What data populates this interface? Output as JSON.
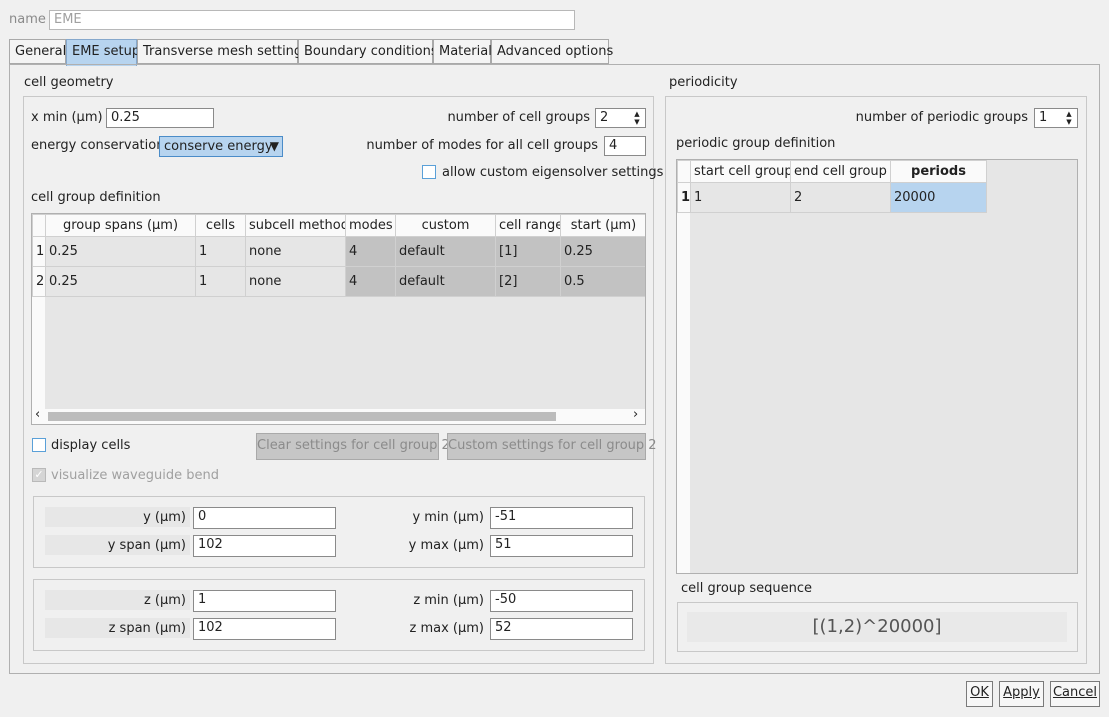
{
  "name_row": {
    "label": "name",
    "value": "EME"
  },
  "tabs": [
    {
      "label": "General"
    },
    {
      "label": "EME setup"
    },
    {
      "label": "Transverse mesh settings"
    },
    {
      "label": "Boundary conditions"
    },
    {
      "label": "Material"
    },
    {
      "label": "Advanced options"
    }
  ],
  "cell_geometry": {
    "title": "cell geometry",
    "xmin_label": "x min (μm)",
    "xmin_value": "0.25",
    "num_groups_label": "number of cell groups",
    "num_groups_value": "2",
    "energy_label": "energy conservation",
    "energy_value": "conserve energy",
    "num_modes_label": "number of modes for all cell groups",
    "num_modes_value": "4",
    "allow_custom_label": "allow custom eigensolver settings",
    "group_def_title": "cell group definition",
    "table": {
      "headers": [
        "group spans (μm)",
        "cells",
        "subcell method",
        "modes",
        "custom",
        "cell range",
        "start (μm)"
      ],
      "rows": [
        {
          "num": "1",
          "cells": [
            "0.25",
            "1",
            "none",
            "4",
            "default",
            "[1]",
            "0.25"
          ]
        },
        {
          "num": "2",
          "cells": [
            "0.25",
            "1",
            "none",
            "4",
            "default",
            "[2]",
            "0.5"
          ]
        }
      ]
    },
    "display_cells_label": "display cells",
    "clear_btn": "Clear settings for cell group 2",
    "custom_btn": "Custom settings for cell group 2",
    "visualize_label": "visualize waveguide bend",
    "y_label": "y (μm)",
    "y_value": "0",
    "ymin_label": "y min (μm)",
    "ymin_value": "-51",
    "yspan_label": "y span (μm)",
    "yspan_value": "102",
    "ymax_label": "y max (μm)",
    "ymax_value": "51",
    "z_label": "z (μm)",
    "z_value": "1",
    "zmin_label": "z min (μm)",
    "zmin_value": "-50",
    "zspan_label": "z span (μm)",
    "zspan_value": "102",
    "zmax_label": "z max (μm)",
    "zmax_value": "52"
  },
  "periodicity": {
    "title": "periodicity",
    "num_periodic_label": "number of periodic groups",
    "num_periodic_value": "1",
    "group_def_title": "periodic group definition",
    "table": {
      "headers": [
        "start cell group",
        "end cell group",
        "periods"
      ],
      "rows": [
        {
          "num": "1",
          "cells": [
            "1",
            "2",
            "20000"
          ]
        }
      ]
    },
    "sequence_title": "cell group sequence",
    "sequence_value": "[(1,2)^20000]"
  },
  "buttons": {
    "ok": "OK",
    "apply": "Apply",
    "cancel": "Cancel"
  },
  "colors": {
    "active_tab": "#b7d4ef",
    "selected_cell": "#b7d4ef",
    "focus_border": "#5aa0d8"
  }
}
